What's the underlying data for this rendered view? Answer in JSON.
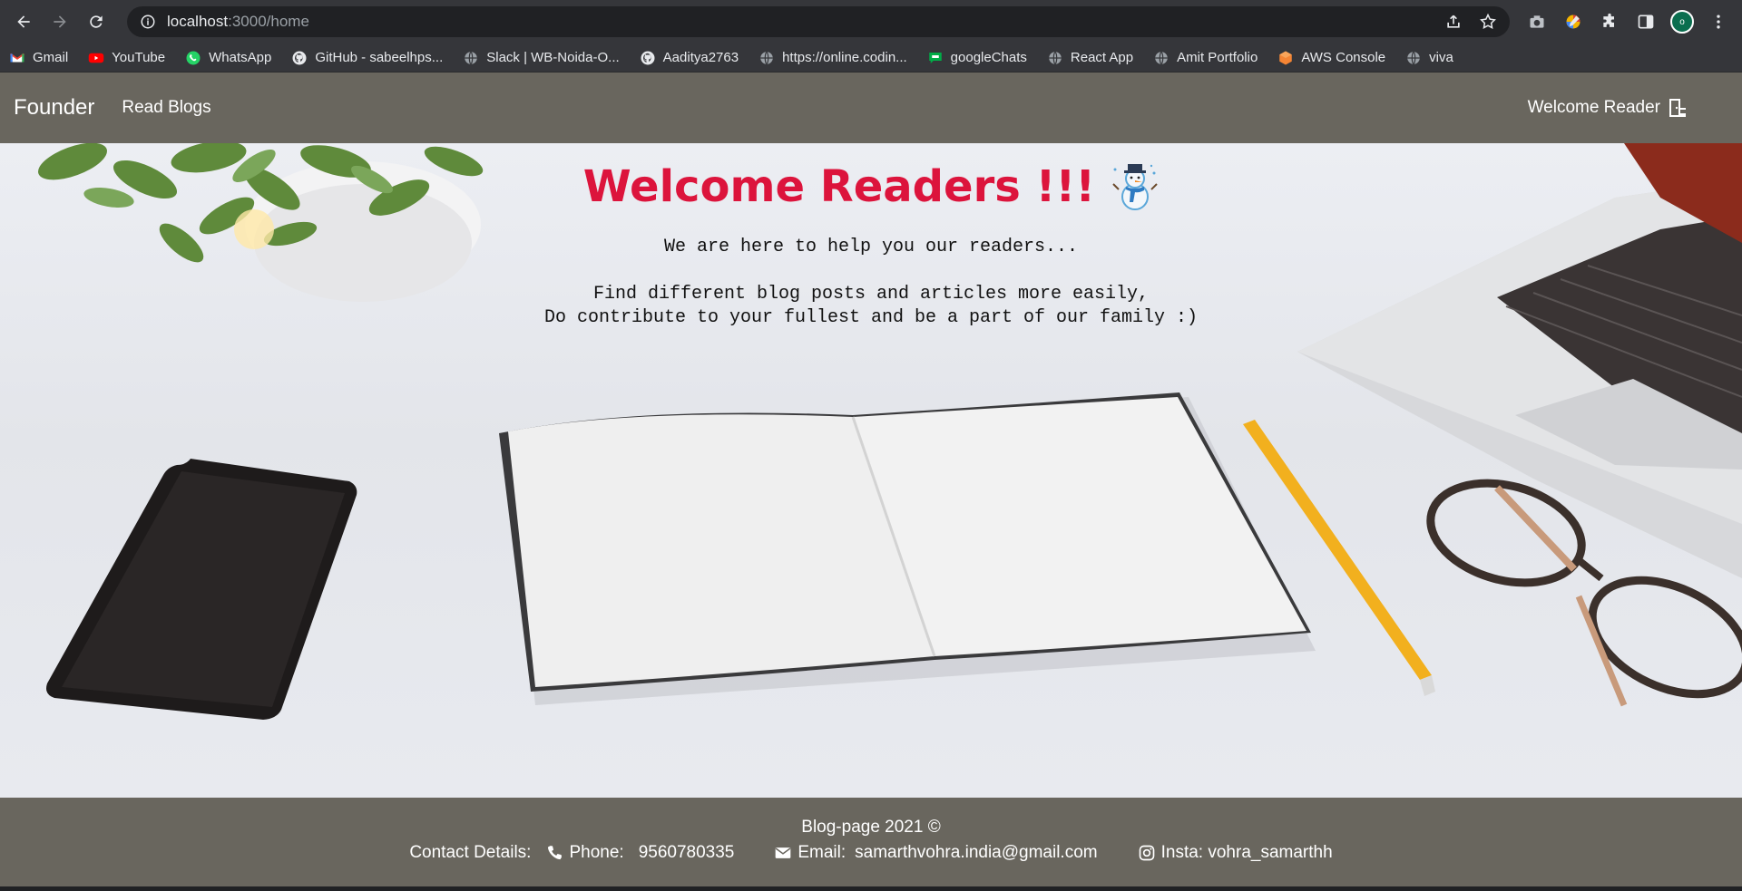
{
  "browser": {
    "url_host": "localhost",
    "url_path": ":3000/home",
    "profile_initial": "o",
    "bookmarks": [
      {
        "label": "Gmail",
        "icon": "gmail-icon"
      },
      {
        "label": "YouTube",
        "icon": "youtube-icon"
      },
      {
        "label": "WhatsApp",
        "icon": "whatsapp-icon"
      },
      {
        "label": "GitHub - sabeelhps...",
        "icon": "github-icon"
      },
      {
        "label": "Slack | WB-Noida-O...",
        "icon": "globe-icon"
      },
      {
        "label": "Aaditya2763",
        "icon": "github-icon"
      },
      {
        "label": "https://online.codin...",
        "icon": "globe-icon"
      },
      {
        "label": "googleChats",
        "icon": "google-chat-icon"
      },
      {
        "label": "React App",
        "icon": "globe-icon"
      },
      {
        "label": "Amit Portfolio",
        "icon": "globe-icon"
      },
      {
        "label": "AWS Console",
        "icon": "aws-icon"
      },
      {
        "label": "viva",
        "icon": "globe-icon"
      }
    ]
  },
  "navbar": {
    "brand": "Founder",
    "read_blogs": "Read Blogs",
    "welcome": "Welcome Reader"
  },
  "hero": {
    "title": "Welcome Readers !!!",
    "line1": "We are here to help you our readers...",
    "line2": "Find different blog posts and articles more easily,",
    "line3": "Do contribute to your fullest and be a part of our family :)"
  },
  "footer": {
    "copyright": "Blog-page 2021 ©",
    "contact_label": "Contact Details:",
    "phone_label": "Phone:",
    "phone_value": "9560780335",
    "email_label": "Email:",
    "email_value": "samarthvohra.india@gmail.com",
    "insta_label": "Insta: vohra_samarthh"
  },
  "colors": {
    "title": "#dc143c",
    "navbar_bg": "#69665e",
    "chrome_bg": "#35363a"
  }
}
